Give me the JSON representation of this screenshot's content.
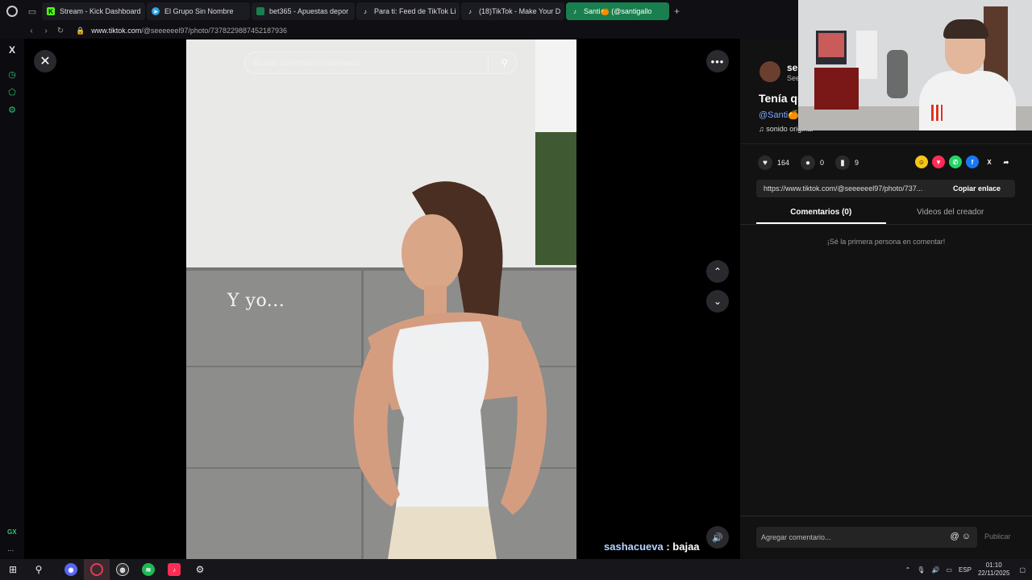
{
  "browser": {
    "tabs": [
      {
        "label": "Stream - Kick Dashboard",
        "icon": "kick-icon",
        "color": "#53fc18"
      },
      {
        "label": "El Grupo Sin Nombre",
        "icon": "telegram-icon",
        "color": "#2aa3e0"
      },
      {
        "label": "bet365 - Apuestas depor",
        "icon": "bet365-icon",
        "color": "#1a7f4e"
      },
      {
        "label": "Para ti: Feed de TikTok Li",
        "icon": "tiktok-icon",
        "color": "#ffffff"
      },
      {
        "label": "(18)TikTok - Make Your D",
        "icon": "tiktok-icon",
        "color": "#ffffff"
      },
      {
        "label": "Santi🍊 (@santigallo",
        "icon": "tiktok-icon",
        "color": "#ffffff",
        "active": true
      }
    ],
    "new_tab": "+",
    "url_host": "www.tiktok.com",
    "url_path": "/@seeeeeel97/photo/7378229887452187936"
  },
  "sidebar": {
    "x_label": "X",
    "gx_label": "GX",
    "more_label": "..."
  },
  "player": {
    "close_label": "✕",
    "search_placeholder": "Buscar contenido relacionado",
    "photo_caption": "Y yo...",
    "more_label": "•••",
    "up_label": "⌃",
    "down_label": "⌄",
    "volume_label": "🔊",
    "chat_user": "sashacueva",
    "chat_sep": " : ",
    "chat_message": "bajaa"
  },
  "details": {
    "author_name": "se",
    "author_sub": "See",
    "title": "Tenía qu",
    "mention": "@Santi🍊",
    "sound": "♫  sonido original",
    "likes": "164",
    "comments": "0",
    "saves": "9",
    "share_icons": [
      {
        "name": "embed-icon",
        "color": "#f5c518",
        "glyph": "☺"
      },
      {
        "name": "send-icon",
        "color": "#fe2c55",
        "glyph": "▼"
      },
      {
        "name": "whatsapp-icon",
        "color": "#25d366",
        "glyph": "✆"
      },
      {
        "name": "facebook-icon",
        "color": "#1877f2",
        "glyph": "f"
      },
      {
        "name": "x-icon",
        "color": "#121212",
        "glyph": "X"
      },
      {
        "name": "share-arrow-icon",
        "color": "#121212",
        "glyph": "➦"
      }
    ],
    "link_url": "https://www.tiktok.com/@seeeeeel97/photo/737...",
    "copy_label": "Copiar enlace",
    "tab_comments": "Comentarios (0)",
    "tab_creator": "Videos del creador",
    "empty_comments": "¡Sé la primera persona en comentar!",
    "comment_placeholder": "Agregar comentario...",
    "comment_icons": "@ ☺",
    "publish_label": "Publicar"
  },
  "taskbar": {
    "lang": "ESP",
    "time": "01:10",
    "date": "22/11/2025"
  }
}
